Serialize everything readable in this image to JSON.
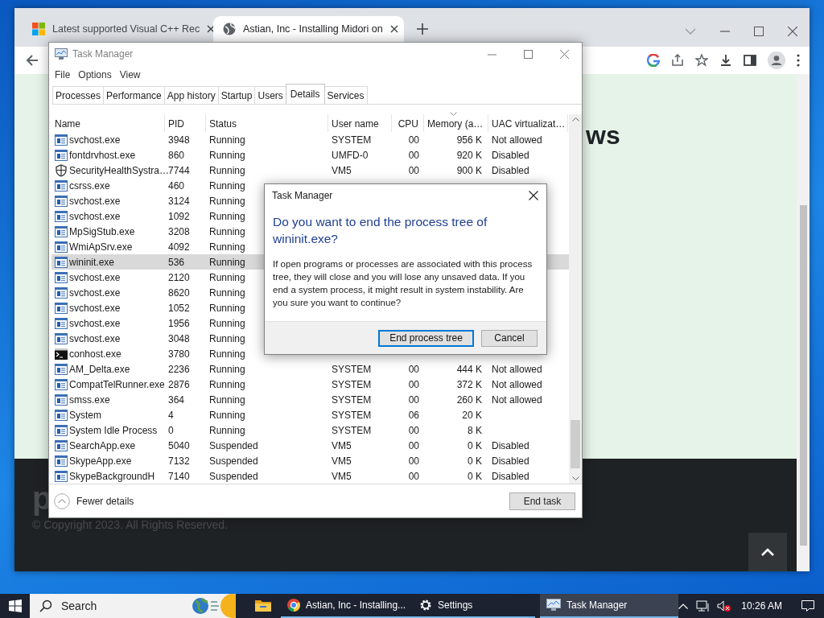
{
  "browser": {
    "tabs": [
      {
        "kind": "squares",
        "title": "Latest supported Visual C++ Rec",
        "selected": false
      },
      {
        "kind": "globe",
        "title": "Astian, Inc - Installing Midori on",
        "selected": true
      }
    ],
    "page": {
      "heading": "ws",
      "footer_mark": "p",
      "copyright": "© Copyright 2023. All Rights Reserved."
    }
  },
  "task_manager": {
    "title": "Task Manager",
    "menu": [
      "File",
      "Options",
      "View"
    ],
    "tabs": [
      {
        "label": "Processes",
        "selected": false
      },
      {
        "label": "Performance",
        "selected": false
      },
      {
        "label": "App history",
        "selected": false
      },
      {
        "label": "Startup",
        "selected": false
      },
      {
        "label": "Users",
        "selected": false
      },
      {
        "label": "Details",
        "selected": true
      },
      {
        "label": "Services",
        "selected": false
      }
    ],
    "columns": [
      "Name",
      "PID",
      "Status",
      "User name",
      "CPU",
      "Memory (a…",
      "UAC virtualizat…"
    ],
    "rows": [
      {
        "kind": "app",
        "selected": false,
        "name": "svchost.exe",
        "pid": "3948",
        "status": "Running",
        "user": "SYSTEM",
        "cpu": "00",
        "memory": "956 K",
        "uac": "Not allowed"
      },
      {
        "kind": "app",
        "selected": false,
        "name": "fontdrvhost.exe",
        "pid": "860",
        "status": "Running",
        "user": "UMFD-0",
        "cpu": "00",
        "memory": "920 K",
        "uac": "Disabled"
      },
      {
        "kind": "shield",
        "selected": false,
        "name": "SecurityHealthSystra…",
        "pid": "7744",
        "status": "Running",
        "user": "VM5",
        "cpu": "00",
        "memory": "900 K",
        "uac": "Disabled"
      },
      {
        "kind": "app",
        "selected": false,
        "name": "csrss.exe",
        "pid": "460",
        "status": "Running"
      },
      {
        "kind": "app",
        "selected": false,
        "name": "svchost.exe",
        "pid": "3124",
        "status": "Running"
      },
      {
        "kind": "app",
        "selected": false,
        "name": "svchost.exe",
        "pid": "1092",
        "status": "Running"
      },
      {
        "kind": "app",
        "selected": false,
        "name": "MpSigStub.exe",
        "pid": "3208",
        "status": "Running"
      },
      {
        "kind": "app",
        "selected": false,
        "name": "WmiApSrv.exe",
        "pid": "4092",
        "status": "Running"
      },
      {
        "kind": "app",
        "selected": true,
        "name": "wininit.exe",
        "pid": "536",
        "status": "Running"
      },
      {
        "kind": "app",
        "selected": false,
        "name": "svchost.exe",
        "pid": "2120",
        "status": "Running"
      },
      {
        "kind": "app",
        "selected": false,
        "name": "svchost.exe",
        "pid": "8620",
        "status": "Running"
      },
      {
        "kind": "app",
        "selected": false,
        "name": "svchost.exe",
        "pid": "1052",
        "status": "Running"
      },
      {
        "kind": "app",
        "selected": false,
        "name": "svchost.exe",
        "pid": "1956",
        "status": "Running"
      },
      {
        "kind": "app",
        "selected": false,
        "name": "svchost.exe",
        "pid": "3048",
        "status": "Running"
      },
      {
        "kind": "console",
        "selected": false,
        "name": "conhost.exe",
        "pid": "3780",
        "status": "Running"
      },
      {
        "kind": "app",
        "selected": false,
        "name": "AM_Delta.exe",
        "pid": "2236",
        "status": "Running",
        "user": "SYSTEM",
        "cpu": "00",
        "memory": "444 K",
        "uac": "Not allowed"
      },
      {
        "kind": "app",
        "selected": false,
        "name": "CompatTelRunner.exe",
        "pid": "2876",
        "status": "Running",
        "user": "SYSTEM",
        "cpu": "00",
        "memory": "372 K",
        "uac": "Not allowed"
      },
      {
        "kind": "app",
        "selected": false,
        "name": "smss.exe",
        "pid": "364",
        "status": "Running",
        "user": "SYSTEM",
        "cpu": "00",
        "memory": "260 K",
        "uac": "Not allowed"
      },
      {
        "kind": "app",
        "selected": false,
        "name": "System",
        "pid": "4",
        "status": "Running",
        "user": "SYSTEM",
        "cpu": "06",
        "memory": "20 K"
      },
      {
        "kind": "app",
        "selected": false,
        "name": "System Idle Process",
        "pid": "0",
        "status": "Running",
        "user": "SYSTEM",
        "cpu": "00",
        "memory": "8 K"
      },
      {
        "kind": "app",
        "selected": false,
        "name": "SearchApp.exe",
        "pid": "5040",
        "status": "Suspended",
        "user": "VM5",
        "cpu": "00",
        "memory": "0 K",
        "uac": "Disabled"
      },
      {
        "kind": "app",
        "selected": false,
        "name": "SkypeApp.exe",
        "pid": "7132",
        "status": "Suspended",
        "user": "VM5",
        "cpu": "00",
        "memory": "0 K",
        "uac": "Disabled"
      },
      {
        "kind": "app",
        "selected": false,
        "name": "SkypeBackgroundH",
        "pid": "7140",
        "status": "Suspended",
        "user": "VM5",
        "cpu": "00",
        "memory": "0 K",
        "uac": "Disabled"
      }
    ],
    "footer": {
      "toggle": "Fewer details",
      "button": "End task"
    }
  },
  "dialog": {
    "title": "Task Manager",
    "heading": "Do you want to end the process tree of wininit.exe?",
    "message": "If open programs or processes are associated with this process tree, they will close and you will lose any unsaved data. If you end a system process, it might result in system instability. Are you sure you want to continue?",
    "buttons": [
      {
        "label": "End process tree",
        "default": true
      },
      {
        "label": "Cancel",
        "default": false
      }
    ]
  },
  "taskbar": {
    "search": {
      "placeholder": "Search"
    },
    "apps": [
      {
        "kind": "folder",
        "open": false,
        "selected": false
      },
      {
        "kind": "browser",
        "label": "Astian, Inc - Installing...",
        "open": true,
        "selected": false
      },
      {
        "kind": "settings",
        "label": "Settings",
        "open": true,
        "selected": false
      },
      {
        "kind": "taskmgr",
        "label": "Task Manager",
        "open": true,
        "selected": true
      }
    ],
    "clock": "10:26 AM"
  }
}
